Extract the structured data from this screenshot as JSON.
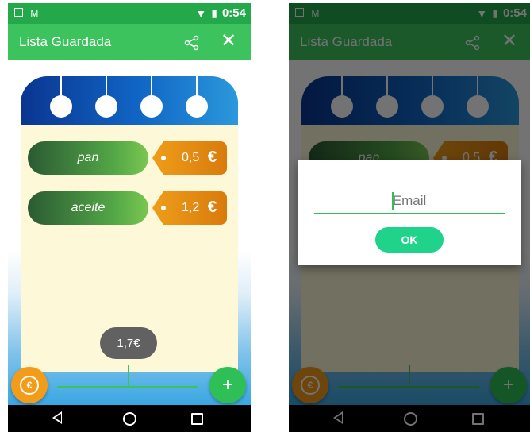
{
  "status_bar": {
    "time": "0:54"
  },
  "app_bar": {
    "title": "Lista Guardada",
    "share_icon": "share-icon",
    "close_icon": "close-icon",
    "close_glyph": "✕"
  },
  "items": [
    {
      "name": "pan",
      "price": "0,5",
      "currency": "€"
    },
    {
      "name": "aceite",
      "price": "1,2",
      "currency": "€"
    }
  ],
  "total": "1,7€",
  "fab": {
    "euro_glyph": "€",
    "add_glyph": "+"
  },
  "dialog": {
    "email_placeholder": "Email",
    "ok_label": "OK"
  },
  "colors": {
    "app_bar": "#3cc35e",
    "status_bar": "#23a84a",
    "item_pill": "#52a546",
    "price_tag": "#e38a12",
    "ok_button": "#1fd38a"
  }
}
